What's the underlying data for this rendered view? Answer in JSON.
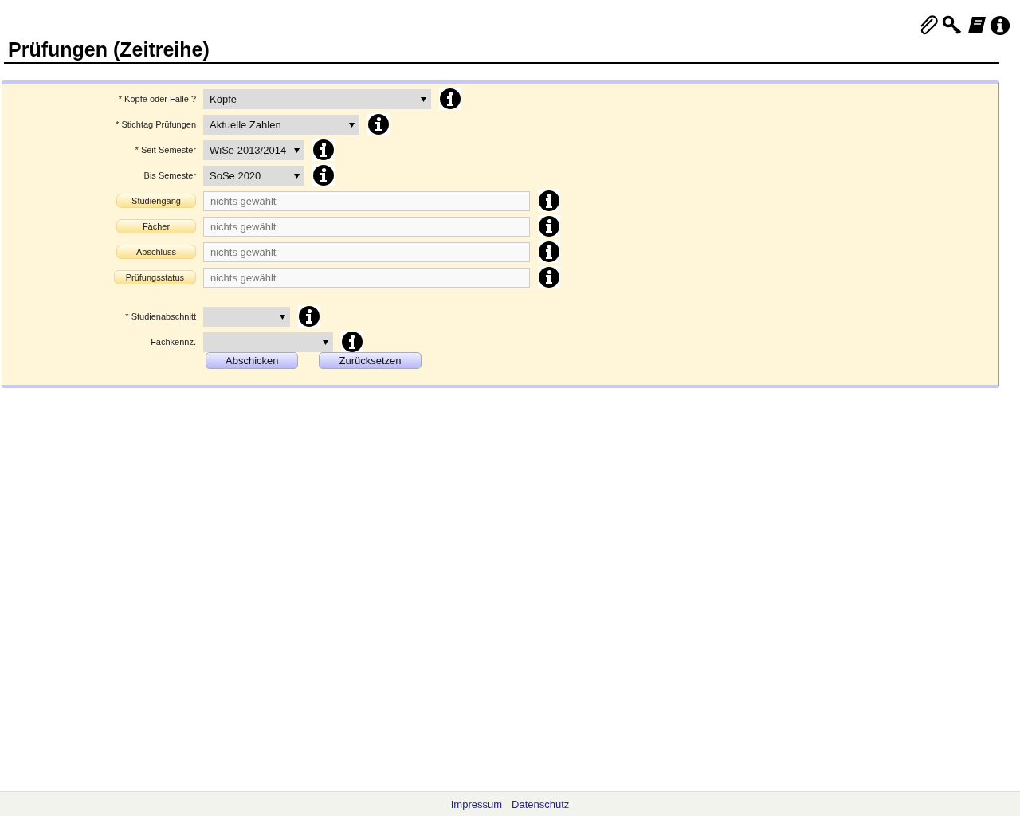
{
  "title": "Prüfungen (Zeitreihe)",
  "fields": [
    {
      "kind": "select",
      "label": "* Köpfe oder Fälle ?",
      "value": "Köpfe"
    },
    {
      "kind": "select",
      "label": "* Stichtag Prüfungen",
      "value": "Aktuelle Zahlen"
    },
    {
      "kind": "select",
      "label": "* Seit Semester",
      "value": "WiSe 2013/2014"
    },
    {
      "kind": "select",
      "label": "Bis Semester",
      "value": "SoSe 2020"
    },
    {
      "kind": "picker",
      "label": "Studiengang",
      "placeholder": "nichts gewählt"
    },
    {
      "kind": "picker",
      "label": "Fächer",
      "placeholder": "nichts gewählt"
    },
    {
      "kind": "picker",
      "label": "Abschluss",
      "placeholder": "nichts gewählt"
    },
    {
      "kind": "picker",
      "label": "Prüfungsstatus",
      "placeholder": "nichts gewählt"
    }
  ],
  "extra_fields": [
    {
      "kind": "select",
      "label": "* Studienabschnitt"
    },
    {
      "kind": "select",
      "label": "Fachkennz."
    }
  ],
  "buttons": [
    "Abschicken",
    "Zurücksetzen"
  ],
  "footer_links": [
    "Impressum",
    "Datenschutz"
  ]
}
